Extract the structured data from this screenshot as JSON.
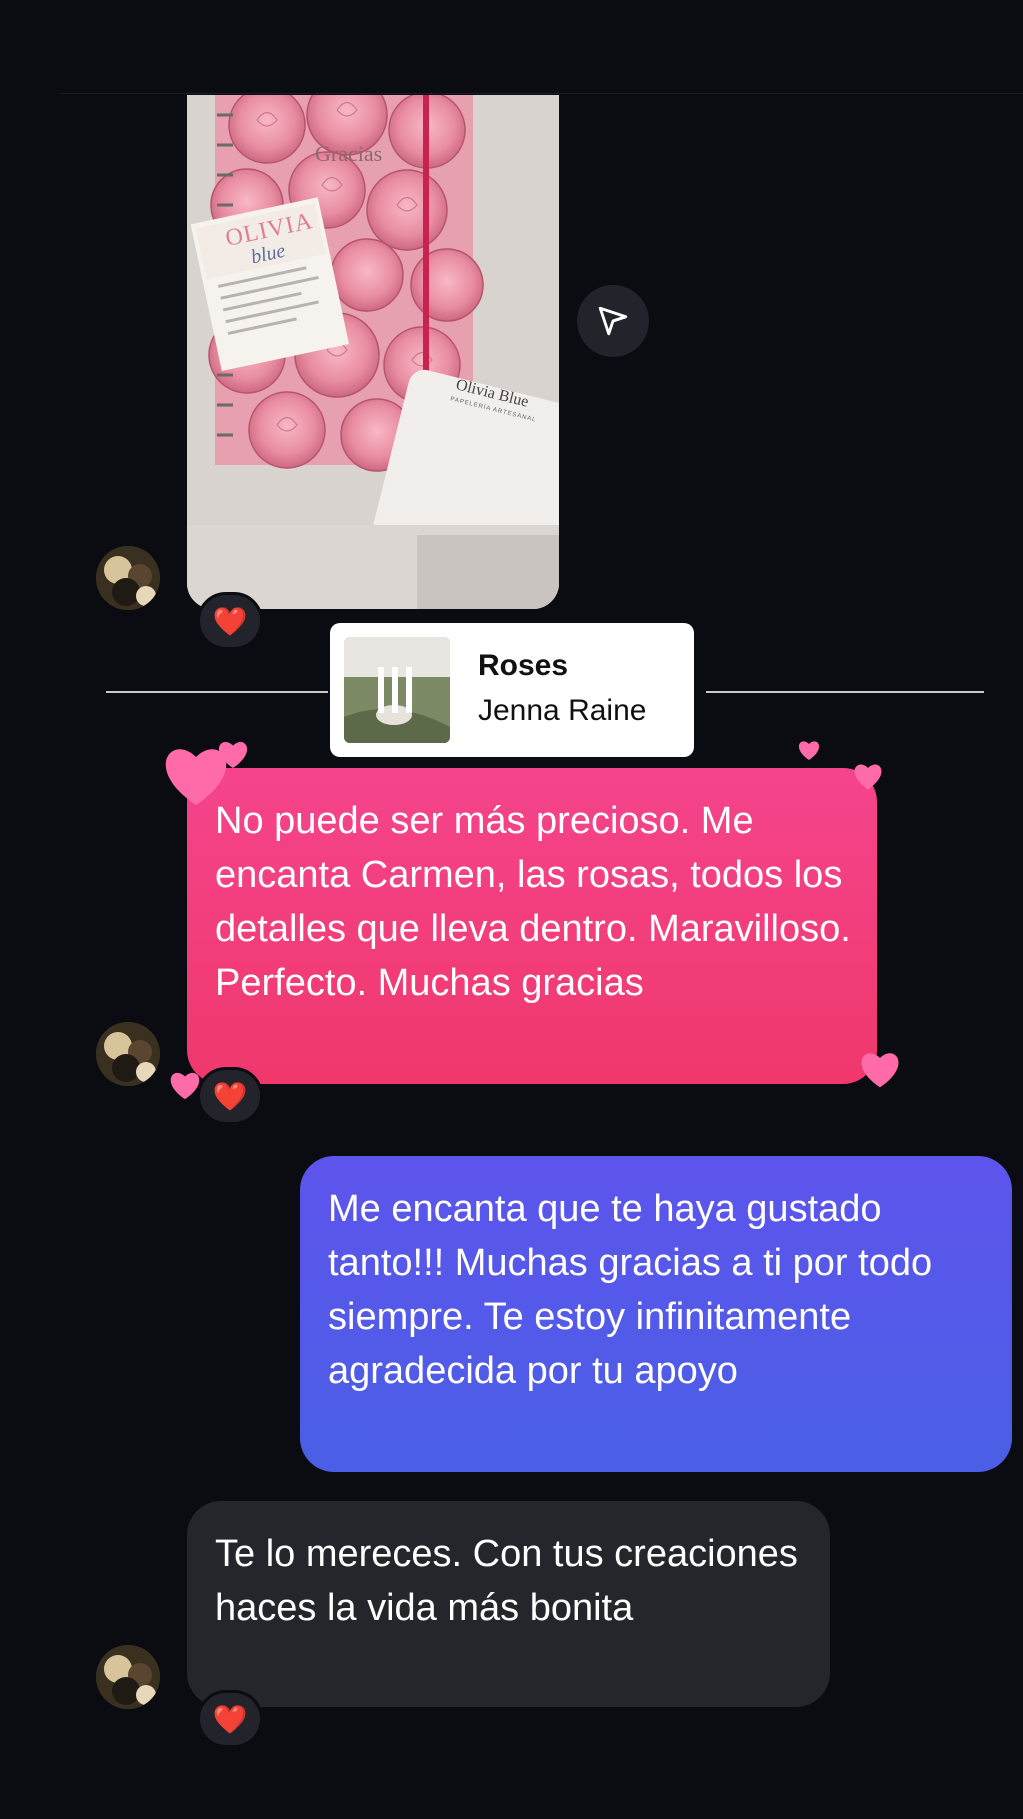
{
  "photo_message": {
    "image_alt": "Libreta con rosas y tarjeta Olivia Blue",
    "notebook_text": "Gracias",
    "card_brand": "OLIVIA",
    "card_brand_sub": "blue",
    "box_brand": "Olivia Blue",
    "box_brand_sub": "PAPELERÍA ARTESANAL",
    "reaction": "❤️"
  },
  "share_button": {
    "icon": "send-icon"
  },
  "music_sticker": {
    "title": "Roses",
    "artist": "Jenna Raine"
  },
  "messages": [
    {
      "sender": "other",
      "text": "No puede ser más precioso. Me encanta Carmen, las rosas, todos los detalles que lleva dentro. Maravilloso. Perfecto. Muchas gracias",
      "reaction": "❤️",
      "color": "#f0407a"
    },
    {
      "sender": "me",
      "text": "Me encanta que te haya gustado tanto!!! Muchas gracias a ti por todo siempre. Te estoy infinitamente agradecida por tu apoyo",
      "color": "#5158ea"
    },
    {
      "sender": "other",
      "text": "Te lo mereces. Con tus creaciones haces la vida más bonita",
      "reaction": "❤️",
      "color": "#25262c"
    }
  ]
}
